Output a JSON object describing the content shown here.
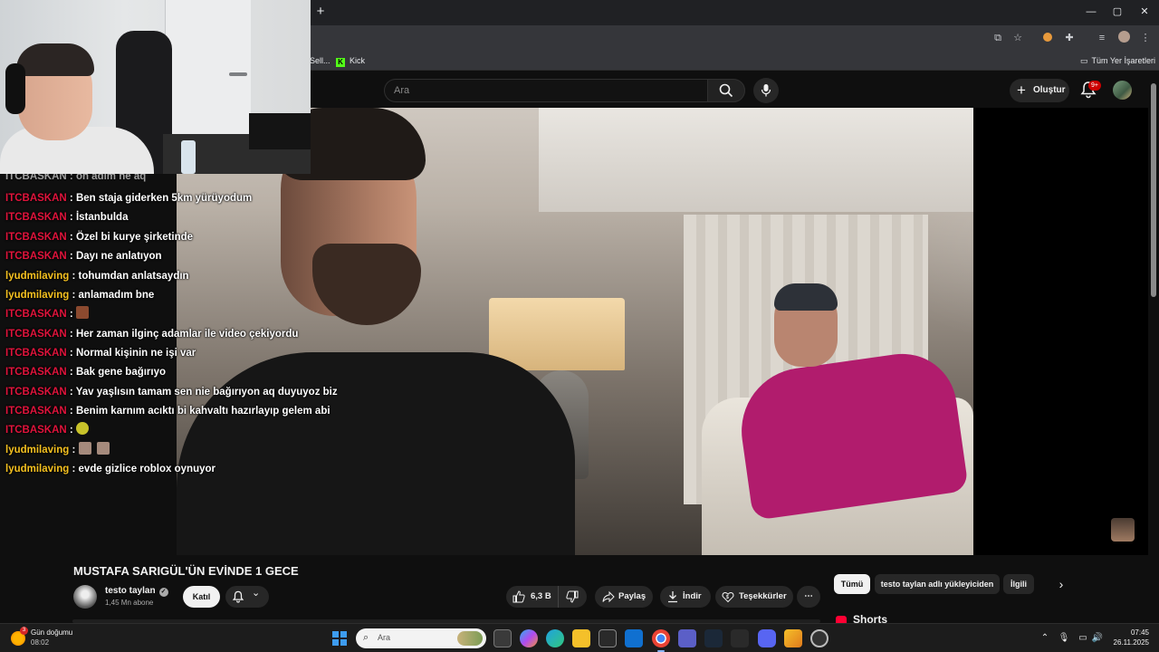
{
  "browser": {
    "bookmarks": [
      {
        "label": "Sell..."
      },
      {
        "label": "Kick"
      }
    ],
    "all_bookmarks_label": "Tüm Yer İşaretleri"
  },
  "youtube": {
    "search_placeholder": "Ara",
    "create_label": "Oluştur",
    "notification_count": "9+",
    "video": {
      "title": "MUSTAFA SARIGÜL'ÜN EVİNDE 1 GECE",
      "channel_name": "testo taylan",
      "subscribers": "1,45 Mn abone",
      "join_label": "Katıl",
      "likes": "6,3 B",
      "share_label": "Paylaş",
      "download_label": "İndir",
      "thanks_label": "Teşekkürler"
    },
    "chips": [
      {
        "label": "Tümü",
        "active": true
      },
      {
        "label": "testo taylan adlı yükleyiciden",
        "active": false
      },
      {
        "label": "İlgili",
        "active": false
      }
    ],
    "shorts_label": "Shorts"
  },
  "chat": {
    "partial_top": "ITCBASKAN : on adım ne aq",
    "messages": [
      {
        "user": "ITCBASKAN",
        "color": "#e0143c",
        "text": "Ben staja giderken 5km yürüyodum"
      },
      {
        "user": "ITCBASKAN",
        "color": "#e0143c",
        "text": "İstanbulda"
      },
      {
        "user": "ITCBASKAN",
        "color": "#e0143c",
        "text": "Özel bi kurye şirketinde"
      },
      {
        "user": "ITCBASKAN",
        "color": "#e0143c",
        "text": "Dayı ne anlatıyon"
      },
      {
        "user": "lyudmilaving",
        "color": "#f4c020",
        "text": "tohumdan anlatsaydın"
      },
      {
        "user": "lyudmilaving",
        "color": "#f4c020",
        "text": "anlamadım bne"
      },
      {
        "user": "ITCBASKAN",
        "color": "#e0143c",
        "text": "",
        "emotes": [
          "#8b4a2f"
        ]
      },
      {
        "user": "ITCBASKAN",
        "color": "#e0143c",
        "text": "Her zaman ilginç adamlar ile video çekiyordu"
      },
      {
        "user": "ITCBASKAN",
        "color": "#e0143c",
        "text": "Normal kişinin ne işi var"
      },
      {
        "user": "ITCBASKAN",
        "color": "#e0143c",
        "text": "Bak gene bağırıyo"
      },
      {
        "user": "ITCBASKAN",
        "color": "#e0143c",
        "text": "Yav yaşlısın tamam sen nie bağırıyon aq duyuyoz biz"
      },
      {
        "user": "ITCBASKAN",
        "color": "#e0143c",
        "text": "Benim karnım acıktı bi kahvaltı hazırlayıp gelem abi"
      },
      {
        "user": "ITCBASKAN",
        "color": "#e0143c",
        "text": "",
        "emotes": [
          "#c8c22a"
        ]
      },
      {
        "user": "lyudmilaving",
        "color": "#f4c020",
        "text": "",
        "emotes": [
          "#a58a7c",
          "#a58a7c"
        ]
      },
      {
        "user": "lyudmilaving",
        "color": "#f4c020",
        "text": "evde gizlice roblox oynuyor"
      }
    ]
  },
  "taskbar": {
    "weather_badge": "3",
    "weather_title": "Gün doğumu",
    "weather_time": "08:02",
    "search_placeholder": "Ara",
    "time": "07:45",
    "date": "26.11.2025"
  }
}
